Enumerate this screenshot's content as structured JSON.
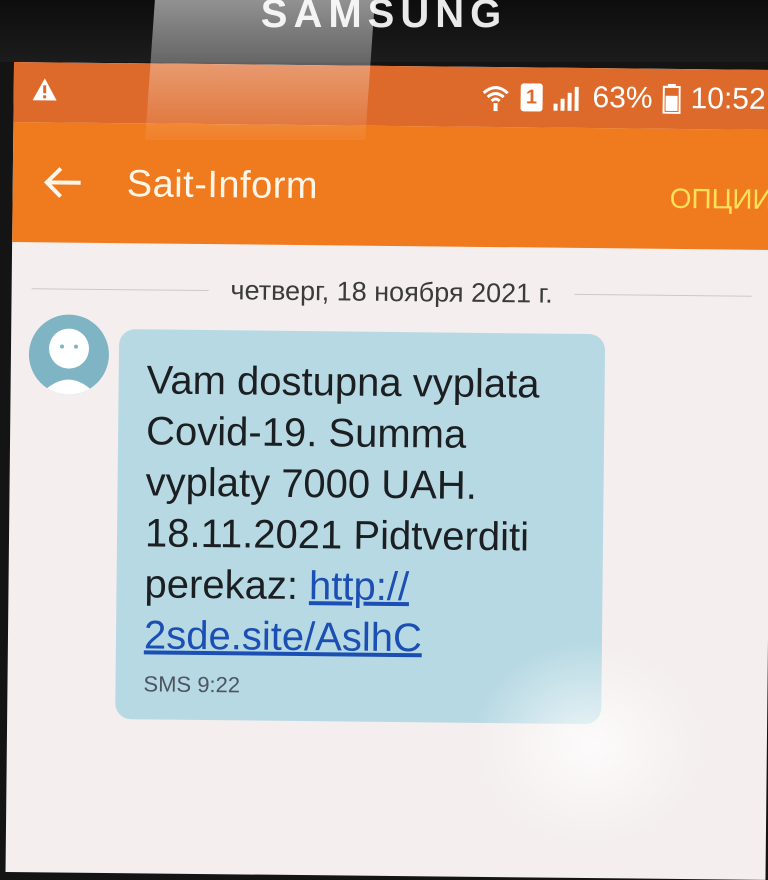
{
  "device": {
    "brand": "SAMSUNG"
  },
  "status_bar": {
    "sim_slot": "1",
    "battery": "63%",
    "battery_level": 0.63,
    "time": "10:52",
    "icons": [
      "warning-icon",
      "wifi-icon",
      "sim-icon",
      "signal-icon",
      "battery-icon"
    ]
  },
  "app_bar": {
    "title": "Sait-Inform",
    "options_label": "ОПЦИИ",
    "back_icon": "back-arrow-icon"
  },
  "thread": {
    "date_separator": "четверг, 18 ноября 2021 г.",
    "messages": [
      {
        "text_lines": [
          "Vam dostupna vyplata",
          "Covid-19. Summa",
          "vyplaty 7000 UAH.",
          "18.11.2021 Pidtverditi",
          "perekaz: "
        ],
        "link_part1": "http://",
        "link_part2": "2sde.site/AslhC",
        "meta": "SMS 9:22"
      }
    ]
  },
  "colors": {
    "status_bar": "#dd6a2a",
    "app_bar": "#f07a1e",
    "options_text": "#ffe15a",
    "bubble": "#b7d9e3",
    "link": "#1b4fb3",
    "background": "#f4eeee"
  }
}
